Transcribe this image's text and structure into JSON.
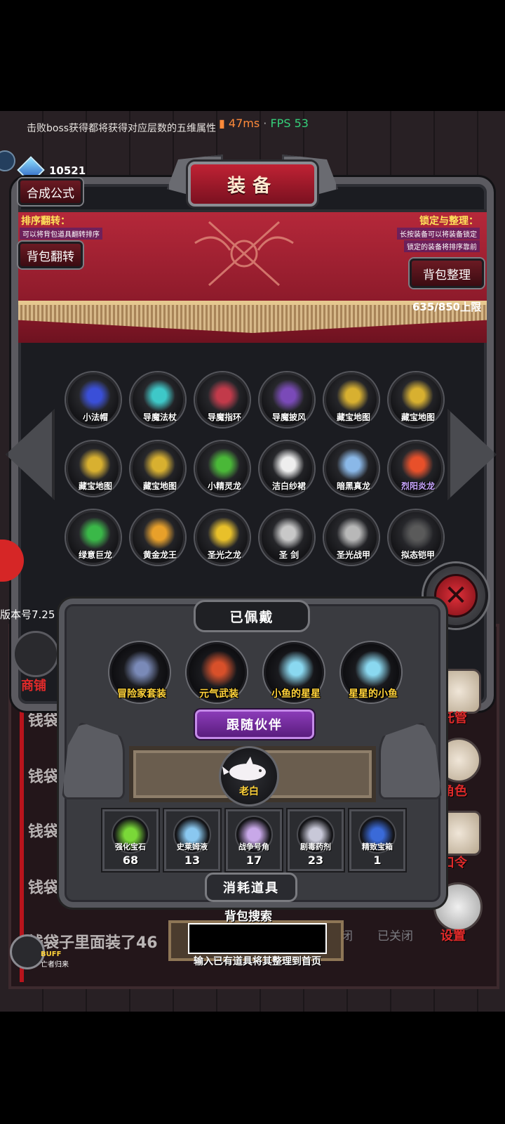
{
  "status": {
    "hint": "击败boss获得都将获得对应层数的五维属性",
    "ping": "47ms",
    "separator": "·",
    "fps": "FPS 53",
    "gem_count": "10521"
  },
  "equipment_panel": {
    "title": "装备",
    "synthesis_button": "合成公式",
    "sort_flip": {
      "title": "排序翻转：",
      "desc": "可以将背包道具翻转排序",
      "button": "背包翻转"
    },
    "lock_sort": {
      "title": "锁定与整理：",
      "desc1": "长按装备可以将装备锁定",
      "desc2": "锁定的装备将排序靠前",
      "button": "背包整理"
    },
    "capacity": "635/850上限",
    "items": [
      {
        "label": "小法帽",
        "icon": "wizard-hat-icon",
        "color": "#3a4fd8"
      },
      {
        "label": "导魔法杖",
        "icon": "magic-staff-icon",
        "color": "#3ec8c8"
      },
      {
        "label": "导魔指环",
        "icon": "ring-icon",
        "color": "#c23a4a"
      },
      {
        "label": "导魔披风",
        "icon": "cloak-icon",
        "color": "#7a4ab8"
      },
      {
        "label": "藏宝地图",
        "icon": "treasure-map-icon",
        "color": "#d8b030"
      },
      {
        "label": "藏宝地图",
        "icon": "treasure-map-icon",
        "color": "#d8b030"
      },
      {
        "label": "藏宝地图",
        "icon": "treasure-map-icon",
        "color": "#d8b030"
      },
      {
        "label": "藏宝地图",
        "icon": "treasure-map-icon",
        "color": "#d8b030"
      },
      {
        "label": "小精灵龙",
        "icon": "fairy-dragon-icon",
        "color": "#4ab838"
      },
      {
        "label": "洁白纱裙",
        "icon": "white-dress-icon",
        "color": "#eeeeee"
      },
      {
        "label": "暗黑真龙",
        "icon": "dark-dragon-icon",
        "color": "#8ab8e8"
      },
      {
        "label": "烈阳炎龙",
        "icon": "sun-dragon-icon",
        "color": "#e8502a"
      },
      {
        "label": "绿意巨龙",
        "icon": "green-dragon-icon",
        "color": "#3ab848"
      },
      {
        "label": "黄金龙王",
        "icon": "gold-dragon-icon",
        "color": "#e8a02a"
      },
      {
        "label": "圣光之龙",
        "icon": "holy-dragon-icon",
        "color": "#e8c02a"
      },
      {
        "label": "圣 剑",
        "icon": "holy-sword-icon",
        "color": "#c8c8c8"
      },
      {
        "label": "圣光战甲",
        "icon": "holy-armor-icon",
        "color": "#b8b8b8"
      },
      {
        "label": "拟态铠甲",
        "icon": "mimic-armor-icon",
        "color": "#5a5a5a"
      }
    ]
  },
  "left_side": {
    "version": "版本号7.25",
    "shop_label": "商铺",
    "bg_texts": [
      "钱袋",
      "钱袋",
      "钱袋",
      "钱袋",
      "钱袋子里面装了46"
    ]
  },
  "worn": {
    "title": "已佩戴",
    "items": [
      {
        "label": "冒险家套装",
        "icon": "adventurer-set-icon",
        "color": "#7a8ab8"
      },
      {
        "label": "元气武装",
        "icon": "vitality-armor-icon",
        "color": "#d8502a"
      },
      {
        "label": "小鱼的星星",
        "icon": "star-sword-icon",
        "color": "#8ad8f0"
      },
      {
        "label": "星星的小鱼",
        "icon": "fish-sword-icon",
        "color": "#8ad8f0"
      }
    ]
  },
  "partner": {
    "title": "跟随伙伴",
    "name": "老白",
    "icon": "white-dolphin-icon"
  },
  "consumables": {
    "title": "消耗道具",
    "items": [
      {
        "name": "强化宝石",
        "count": "68",
        "icon": "upgrade-gem-icon",
        "color": "#7ad838"
      },
      {
        "name": "史莱姆液",
        "count": "13",
        "icon": "slime-potion-icon",
        "color": "#8ac8f0"
      },
      {
        "name": "战争号角",
        "count": "17",
        "icon": "war-horn-icon",
        "color": "#c8a8e8"
      },
      {
        "name": "剧毒药剂",
        "count": "23",
        "icon": "poison-potion-icon",
        "color": "#c8c8d8"
      },
      {
        "name": "精致宝箱",
        "count": "1",
        "icon": "treasure-chest-icon",
        "color": "#3a6ad8"
      }
    ]
  },
  "right_menu": {
    "manage_label": "托管",
    "role_label": "角色",
    "code_label": "口令",
    "settings_label": "设置"
  },
  "search": {
    "title": "背包搜索",
    "placeholder": "",
    "hint": "输入已有道具将其整理到首页"
  },
  "bottom": {
    "closed_a": "闭",
    "closed_b": "已关闭",
    "buff": "BUFF",
    "buff_sub": "亡者归来"
  }
}
